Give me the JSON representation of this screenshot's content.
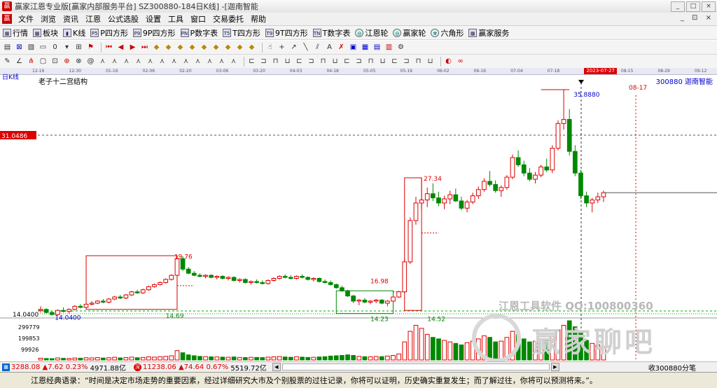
{
  "window": {
    "title": "赢家江恩专业版[赢家内部服务平台] SZ300880-184日K线] -[迦南智能",
    "controls": [
      "_",
      "□",
      "×"
    ]
  },
  "menu": {
    "items": [
      "文件",
      "浏览",
      "资讯",
      "江恩",
      "公式选股",
      "设置",
      "工具",
      "窗口",
      "交易委托",
      "帮助"
    ],
    "right": "_ ⊡ ×"
  },
  "toolbar1": [
    {
      "label": "行情",
      "icon": "grid-icon"
    },
    {
      "label": "板块",
      "icon": "blocks-icon"
    },
    {
      "label": "K线",
      "icon": "candle-icon"
    },
    {
      "label": "P四方形",
      "icon": "p-square-icon",
      "tag": "P5"
    },
    {
      "label": "9P四方形",
      "icon": "9p-square-icon",
      "tag": "P9"
    },
    {
      "label": "P数字表",
      "icon": "p-table-icon",
      "tag": "PN"
    },
    {
      "label": "T四方形",
      "icon": "t-square-icon",
      "tag": "T5"
    },
    {
      "label": "9T四方形",
      "icon": "9t-square-icon",
      "tag": "T9"
    },
    {
      "label": "T数字表",
      "icon": "t-table-icon",
      "tag": "TN"
    },
    {
      "label": "江恩轮",
      "icon": "gann-wheel-icon",
      "tag": "◎"
    },
    {
      "label": "赢家轮",
      "icon": "winner-wheel-icon",
      "tag": "◎"
    },
    {
      "label": "六角形",
      "icon": "hexagon-icon",
      "tag": "✲"
    },
    {
      "label": "赢家服务",
      "icon": "service-icon",
      "tag": "▦"
    }
  ],
  "date_axis": {
    "ticks": [
      "12-16",
      "12-30",
      "01-16",
      "02-06",
      "02-20",
      "03-06",
      "03-20",
      "04-03",
      "04-18",
      "05-05",
      "05-19",
      "06-02",
      "06-16",
      "07-04",
      "07-18",
      "2023-07-27",
      "08-15",
      "08-29",
      "09-12"
    ],
    "highlight": "2023-07-27"
  },
  "chart_header": {
    "period": "日K线",
    "indicator": "老子十二宫结构",
    "stock": "300880  迦南智能"
  },
  "chart_data": {
    "type": "candlestick",
    "ylim": [
      14.04,
      35.88
    ],
    "price_marker": "31.0486",
    "right_label": "08-17",
    "price_labels": [
      "35.8880",
      "27.34",
      "19.76",
      "16.98",
      "14.69",
      "14.23",
      "14.52",
      "14.0400",
      "14.0400"
    ],
    "left_axis": "14.0400",
    "volume_ticks": [
      "299779",
      "199853",
      "99926"
    ],
    "candles": [
      [
        14.5,
        14.9,
        14.3,
        14.6
      ],
      [
        14.6,
        14.7,
        14.2,
        14.3
      ],
      [
        14.3,
        14.4,
        14.0,
        14.1
      ],
      [
        14.1,
        14.6,
        14.0,
        14.5
      ],
      [
        14.5,
        14.8,
        14.3,
        14.4
      ],
      [
        14.4,
        14.7,
        14.2,
        14.6
      ],
      [
        14.6,
        15.0,
        14.5,
        14.9
      ],
      [
        14.9,
        15.1,
        14.7,
        14.8
      ],
      [
        14.8,
        15.2,
        14.7,
        15.1
      ],
      [
        15.1,
        15.4,
        15.0,
        15.2
      ],
      [
        15.2,
        15.5,
        15.1,
        15.4
      ],
      [
        15.4,
        15.6,
        15.2,
        15.3
      ],
      [
        15.3,
        15.7,
        15.2,
        15.6
      ],
      [
        15.6,
        15.9,
        15.5,
        15.8
      ],
      [
        15.8,
        16.0,
        15.6,
        15.7
      ],
      [
        15.7,
        16.1,
        15.6,
        16.0
      ],
      [
        16.0,
        16.4,
        15.9,
        16.3
      ],
      [
        16.3,
        16.5,
        16.1,
        16.2
      ],
      [
        16.2,
        16.6,
        16.1,
        16.5
      ],
      [
        16.5,
        16.9,
        16.4,
        16.8
      ],
      [
        16.8,
        17.1,
        16.7,
        17.0
      ],
      [
        17.0,
        17.3,
        16.9,
        17.2
      ],
      [
        17.2,
        17.6,
        17.1,
        17.5
      ],
      [
        17.5,
        18.0,
        17.4,
        17.9
      ],
      [
        17.9,
        19.8,
        17.8,
        19.5
      ],
      [
        19.5,
        19.76,
        18.3,
        18.5
      ],
      [
        18.5,
        18.7,
        18.0,
        18.1
      ],
      [
        18.1,
        18.3,
        17.8,
        17.9
      ],
      [
        17.9,
        18.1,
        17.7,
        17.8
      ],
      [
        17.8,
        18.0,
        17.6,
        17.9
      ],
      [
        17.9,
        18.0,
        17.6,
        17.7
      ],
      [
        17.7,
        17.9,
        17.5,
        17.8
      ],
      [
        17.8,
        17.9,
        17.5,
        17.6
      ],
      [
        17.6,
        17.8,
        17.4,
        17.7
      ],
      [
        17.7,
        17.8,
        17.3,
        17.4
      ],
      [
        17.4,
        17.6,
        17.2,
        17.5
      ],
      [
        17.5,
        17.6,
        17.1,
        17.2
      ],
      [
        17.2,
        17.4,
        17.0,
        17.3
      ],
      [
        17.3,
        17.5,
        17.1,
        17.2
      ],
      [
        17.2,
        17.4,
        17.0,
        17.1
      ],
      [
        17.1,
        17.5,
        17.0,
        17.4
      ],
      [
        17.4,
        17.7,
        17.3,
        17.6
      ],
      [
        17.6,
        17.9,
        17.5,
        17.8
      ],
      [
        17.8,
        18.0,
        17.6,
        17.7
      ],
      [
        17.7,
        17.9,
        17.5,
        17.6
      ],
      [
        17.6,
        17.9,
        17.5,
        17.8
      ],
      [
        17.8,
        18.0,
        17.6,
        17.7
      ],
      [
        17.7,
        17.8,
        17.4,
        17.5
      ],
      [
        17.5,
        17.7,
        17.3,
        17.6
      ],
      [
        17.6,
        17.7,
        17.2,
        17.3
      ],
      [
        17.3,
        17.5,
        17.1,
        17.2
      ],
      [
        17.2,
        17.4,
        16.9,
        17.0
      ],
      [
        17.0,
        17.1,
        16.6,
        16.7
      ],
      [
        16.7,
        16.9,
        16.3,
        16.4
      ],
      [
        16.4,
        16.5,
        15.8,
        15.9
      ],
      [
        15.9,
        16.0,
        15.2,
        15.4
      ],
      [
        15.4,
        15.6,
        15.0,
        15.5
      ],
      [
        15.5,
        15.7,
        15.2,
        15.3
      ],
      [
        15.3,
        15.5,
        15.1,
        15.4
      ],
      [
        15.4,
        15.6,
        15.2,
        15.5
      ],
      [
        15.5,
        15.6,
        15.1,
        15.2
      ],
      [
        15.2,
        15.5,
        14.9,
        15.4
      ],
      [
        15.4,
        15.9,
        15.3,
        15.8
      ],
      [
        15.8,
        16.4,
        15.7,
        16.3
      ],
      [
        16.3,
        19.5,
        16.2,
        19.2
      ],
      [
        19.2,
        23.5,
        19.0,
        23.2
      ],
      [
        23.2,
        25.5,
        22.8,
        24.9
      ],
      [
        24.9,
        27.34,
        24.2,
        25.2
      ],
      [
        25.2,
        26.4,
        24.5,
        25.8
      ],
      [
        25.8,
        26.8,
        25.1,
        25.4
      ],
      [
        25.4,
        26.0,
        24.6,
        24.9
      ],
      [
        24.9,
        25.6,
        24.3,
        25.3
      ],
      [
        25.3,
        26.1,
        24.8,
        25.7
      ],
      [
        25.7,
        26.3,
        25.0,
        25.1
      ],
      [
        25.1,
        25.5,
        24.2,
        24.4
      ],
      [
        24.4,
        25.2,
        24.0,
        25.0
      ],
      [
        25.0,
        25.9,
        24.8,
        25.6
      ],
      [
        25.6,
        26.5,
        25.3,
        26.2
      ],
      [
        26.2,
        27.3,
        26.0,
        27.0
      ],
      [
        27.0,
        28.0,
        26.5,
        26.7
      ],
      [
        26.7,
        27.1,
        25.9,
        26.1
      ],
      [
        26.1,
        26.6,
        25.5,
        26.4
      ],
      [
        26.4,
        27.6,
        26.2,
        27.4
      ],
      [
        27.4,
        29.6,
        27.2,
        29.3
      ],
      [
        29.3,
        30.0,
        28.4,
        28.6
      ],
      [
        28.6,
        29.0,
        27.5,
        27.8
      ],
      [
        27.8,
        28.3,
        27.0,
        27.2
      ],
      [
        27.2,
        27.9,
        26.8,
        27.6
      ],
      [
        27.6,
        28.6,
        27.4,
        28.4
      ],
      [
        28.4,
        29.2,
        27.9,
        28.1
      ],
      [
        28.1,
        30.5,
        27.8,
        30.2
      ],
      [
        30.2,
        32.9,
        30.0,
        32.6
      ],
      [
        32.6,
        35.88,
        32.0,
        33.0
      ],
      [
        33.0,
        34.0,
        29.5,
        29.9
      ],
      [
        29.9,
        30.5,
        27.5,
        27.8
      ],
      [
        27.8,
        28.1,
        25.3,
        25.6
      ],
      [
        25.6,
        26.0,
        24.5,
        24.9
      ],
      [
        24.9,
        25.4,
        24.0,
        25.2
      ],
      [
        25.2,
        25.9,
        24.9,
        25.5
      ],
      [
        25.5,
        26.1,
        25.0,
        25.9
      ]
    ],
    "volume": [
      12,
      10,
      9,
      14,
      11,
      10,
      13,
      12,
      15,
      14,
      16,
      13,
      15,
      18,
      14,
      16,
      19,
      15,
      17,
      21,
      19,
      22,
      24,
      28,
      62,
      48,
      34,
      28,
      24,
      22,
      21,
      20,
      19,
      18,
      20,
      17,
      16,
      18,
      17,
      16,
      19,
      21,
      23,
      20,
      18,
      22,
      19,
      17,
      18,
      20,
      22,
      26,
      28,
      30,
      34,
      30,
      24,
      22,
      21,
      23,
      22,
      26,
      30,
      40,
      120,
      190,
      230,
      210,
      170,
      150,
      140,
      130,
      120,
      110,
      100,
      115,
      125,
      140,
      160,
      150,
      120,
      125,
      150,
      190,
      170,
      140,
      120,
      125,
      140,
      130,
      160,
      200,
      230,
      260,
      220,
      180,
      130,
      110,
      100,
      90
    ]
  },
  "watermark": {
    "tools_text": "江恩工具软件  QQ:100800360",
    "brand_text": "赢家聊吧"
  },
  "statusbar": {
    "index1": {
      "value": "3288.08",
      "change": "▲7.62",
      "pct": "0.23%",
      "amount": "4971.88亿"
    },
    "index2": {
      "value": "11238.06",
      "change": "▲74.64",
      "pct": "0.67%",
      "amount": "5519.72亿"
    },
    "ticker": "收300880分笔"
  },
  "quote": {
    "text": "江恩经典语录：“时间是决定市场走势的重要因素，经过详细研究大市及个别股票的过往记录，你将可以证明，历史确实重复发生；而了解过往，你将可以预测将来。”。"
  }
}
